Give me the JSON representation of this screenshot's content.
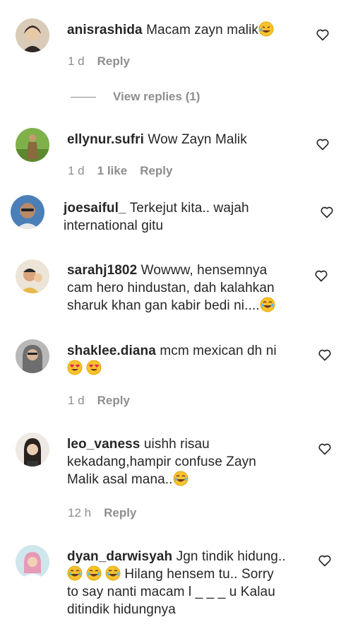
{
  "comments": [
    {
      "username": "anisrashida",
      "text": "Macam zayn malik",
      "emoji": [
        "rofl"
      ],
      "time": "1 d",
      "likes": "",
      "reply": "Reply",
      "view_replies": "View replies (1)"
    },
    {
      "username": "ellynur.sufri",
      "text": "Wow Zayn Malik",
      "time": "1 d",
      "likes": "1 like",
      "reply": "Reply"
    },
    {
      "username": "joesaiful_",
      "text_line1": "Terkejut kita.. wajah",
      "text_line2": "international gitu"
    },
    {
      "username": "sarahj1802",
      "text_line1": "Wowww, hensemnya",
      "text_line2": "cam hero hindustan, dah kalahkan",
      "text_line3": "sharuk khan gan kabir bedi ni....",
      "emoji": [
        "joy"
      ]
    },
    {
      "username": "shaklee.diana",
      "text": "mcm mexican dh ni",
      "emoji": [
        "heart-eyes",
        "heart-eyes"
      ],
      "time": "1 d",
      "reply": "Reply"
    },
    {
      "username": "leo_vaness",
      "text_line1": "uishh risau",
      "text_line2": "kekadang,hampir confuse Zayn",
      "text_line3": "Malik asal mana..",
      "emoji": [
        "joy"
      ],
      "time": "12 h",
      "reply": "Reply"
    },
    {
      "username": "dyan_darwisyah",
      "text_line1": "Jgn tindik hidung..",
      "text_line2": "Hilang hensem tu.. Sorry",
      "text_line3": "to say nanti macam l _ _ _ u Kalau",
      "text_line4": "ditindik hidungnya",
      "emoji": [
        "joy",
        "joy",
        "joy"
      ]
    }
  ],
  "icons": {
    "like": "heart-outline-icon"
  },
  "colors": {
    "text": "#262626",
    "meta": "#8e8e8e"
  }
}
